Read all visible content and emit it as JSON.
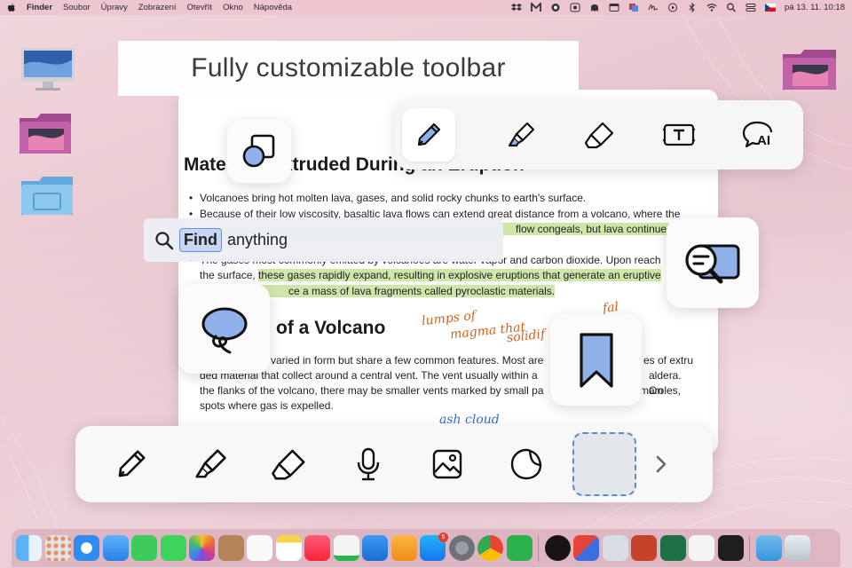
{
  "menubar": {
    "app_name": "Finder",
    "menus": [
      "Soubor",
      "Úpravy",
      "Zobrazení",
      "Otevřít",
      "Okno",
      "Nápověda"
    ],
    "clock": "pá 13. 11.  10:18"
  },
  "banner": {
    "title": "Fully customizable toolbar"
  },
  "document": {
    "heading1": "Materials Extruded During an Eruption",
    "bullets": [
      "Volcanoes bring hot molten lava, gases, and solid rocky chunks to earth's surface.",
      "Because of their low viscosity, basaltic lava flows can extend great distance from a volcano, where the"
    ],
    "bullet2_line2_highlight": "flow congeals, but lava continues",
    "bullet3_line1": "The gases most commonly emitted by volcanoes are water vapor and carbon dioxide. Upon reach",
    "bullet3_line2_start": "the surface, ",
    "bullet3_line2_highlight": "these gases rapidly expand, resulting in explosive eruptions that generate an eruptive",
    "bullet3_line3_highlight": "ce a mass of lava fragments called pyroclastic materials.",
    "heading2": "of a Volcano",
    "paragraph_lines": [
      "varied in form but share a few common features. Most are",
      "ded material that collect around a central vent. The vent  usually within a",
      "the flanks of the volcano, there may be smaller vents marked by small pa",
      "spots where gas is expelled."
    ],
    "paragraph_tails": [
      "es of extru",
      "aldera. On",
      "maroles,"
    ],
    "handwriting": [
      "lumps of",
      "magma that",
      "solidif",
      "fal"
    ],
    "handwriting_blue": "ash cloud"
  },
  "find": {
    "keyword": "Find",
    "rest": "anything"
  },
  "top_toolbar": {
    "tools": [
      "pen-icon",
      "highlighter-icon",
      "eraser-icon",
      "text-box-icon",
      "ai-chat-icon"
    ],
    "active_tool": "pen-icon"
  },
  "bottom_toolbar": {
    "tools": [
      "pen-icon",
      "highlighter-icon",
      "eraser-icon",
      "microphone-icon",
      "image-icon",
      "sticker-icon"
    ]
  },
  "tiles": [
    "shapes-icon",
    "lasso-icon",
    "search-document-icon",
    "bookmark-icon"
  ],
  "dock": {
    "apps": [
      "finder",
      "launchpad",
      "safari",
      "mail",
      "facetime",
      "messages",
      "photos",
      "notes-brown",
      "reminders",
      "notes",
      "music",
      "numbers",
      "keynote",
      "pages",
      "app-store",
      "system-preferences",
      "chrome",
      "feedly",
      "spotify",
      "dropbox-transfer",
      "preview",
      "powerpoint",
      "excel",
      "goodnotes",
      "terminal",
      "folder",
      "trash"
    ],
    "badges": {
      "app-store": "5"
    }
  },
  "colors": {
    "accent": "#5b8ad0",
    "icon_fill": "#8fb0e8",
    "highlight": "#cfe6a9",
    "handwriting": "#d2631b"
  }
}
